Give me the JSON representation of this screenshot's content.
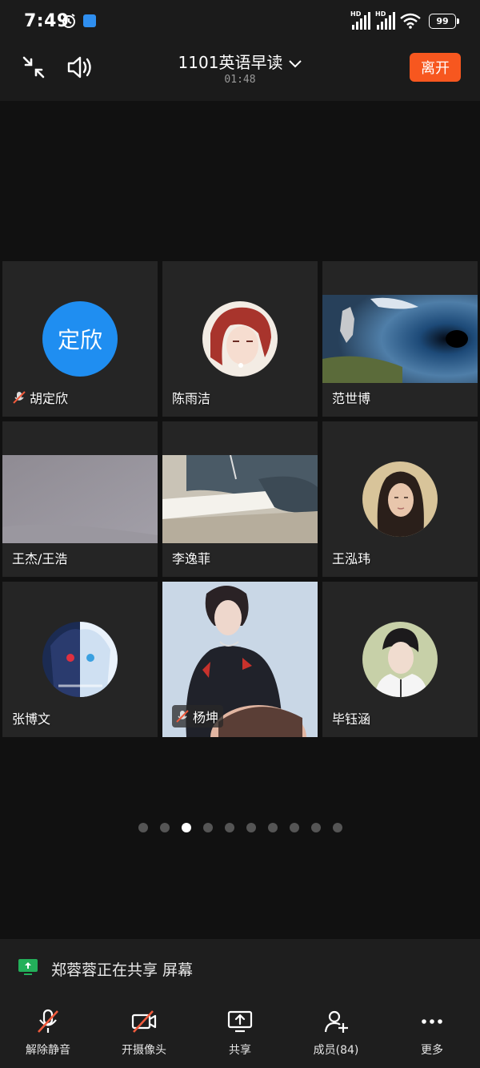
{
  "status": {
    "time": "7:49",
    "signal1": "HD",
    "signal2": "HD",
    "battery": "99"
  },
  "header": {
    "title": "1101英语早读",
    "timer": "01:48",
    "leave_label": "离开"
  },
  "participants": [
    {
      "name": "胡定欣",
      "initials": "定欣",
      "muted": true
    },
    {
      "name": "陈雨洁",
      "muted": false
    },
    {
      "name": "范世博",
      "muted": false
    },
    {
      "name": "王杰/王浩",
      "muted": false
    },
    {
      "name": "李逸菲",
      "muted": false
    },
    {
      "name": "王泓玮",
      "muted": false
    },
    {
      "name": "张博文",
      "muted": false
    },
    {
      "name": "杨坤",
      "muted": true
    },
    {
      "name": "毕钰涵",
      "muted": false
    }
  ],
  "pagination": {
    "total": 10,
    "current": 3
  },
  "share_banner": {
    "text": "郑蓉蓉正在共享 屏幕"
  },
  "toolbar": {
    "unmute": "解除静音",
    "camera": "开摄像头",
    "share": "共享",
    "members": "成员(84)",
    "more": "更多"
  },
  "colors": {
    "accent_leave": "#f7571f",
    "avatar_blue": "#1f8ef1",
    "share_green": "#23b05a",
    "muted_red": "#f05a3c"
  }
}
